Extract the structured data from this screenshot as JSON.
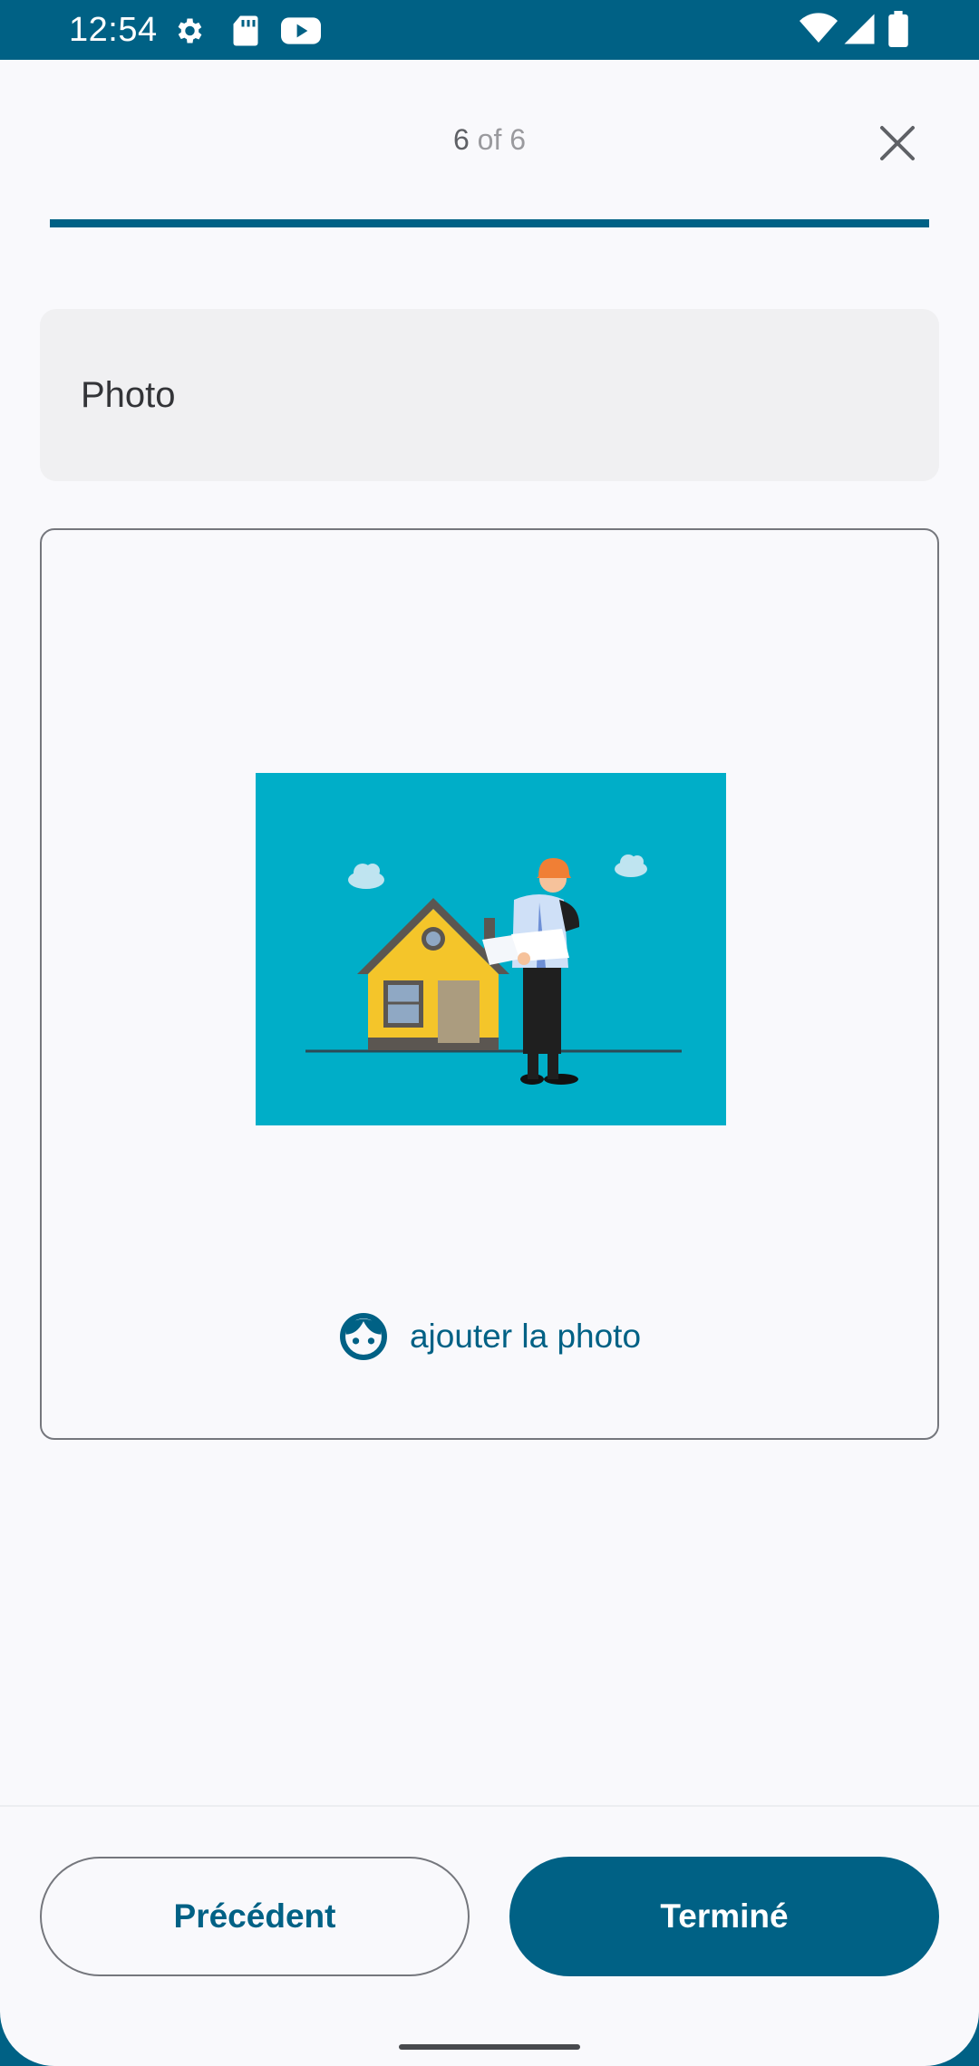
{
  "status_bar": {
    "time": "12:54",
    "icons": [
      "gear-icon",
      "sd-card-icon",
      "youtube-icon",
      "wifi-icon",
      "signal-icon",
      "battery-icon"
    ]
  },
  "header": {
    "step_current": "6",
    "step_separator": "of",
    "step_total": "6",
    "close_icon": "close-icon"
  },
  "progress": {
    "fraction": 1.0
  },
  "question": {
    "title": "Photo"
  },
  "photo_field": {
    "illustration": "house-inspector-illustration",
    "add_icon": "face-icon",
    "add_label": "ajouter la photo"
  },
  "footer": {
    "prev_label": "Précédent",
    "done_label": "Terminé"
  },
  "colors": {
    "primary": "#006185",
    "background": "#f9f9fc",
    "card": "#f0f0f2",
    "illustration_bg": "#00aec8"
  }
}
